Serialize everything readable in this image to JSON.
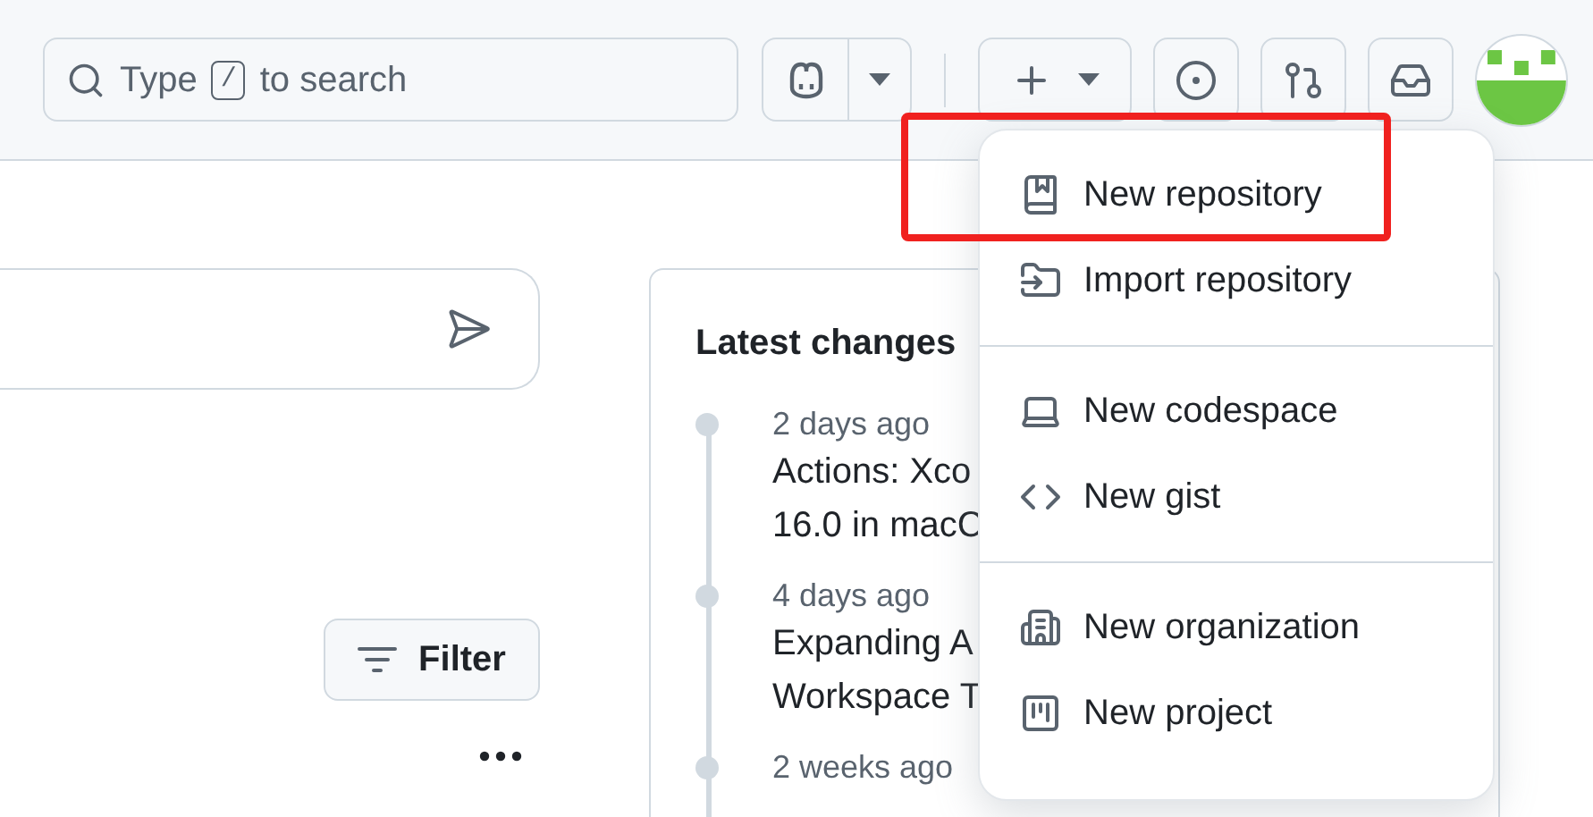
{
  "header": {
    "search": {
      "label_start": "Type",
      "key": "/",
      "label_end": "to search"
    }
  },
  "filter_button": {
    "label": "Filter"
  },
  "latest_changes": {
    "title": "Latest changes",
    "items": [
      {
        "time": "2 days ago",
        "lines": [
          "Actions: Xco",
          "16.0 in macC"
        ]
      },
      {
        "time": "4 days ago",
        "lines": [
          "Expanding A",
          "Workspace T"
        ]
      },
      {
        "time": "2 weeks ago"
      }
    ]
  },
  "create_menu": {
    "groups": [
      [
        {
          "label": "New repository",
          "kind": "repo"
        },
        {
          "label": "Import repository",
          "kind": "import"
        }
      ],
      [
        {
          "label": "New codespace",
          "kind": "codespace"
        },
        {
          "label": "New gist",
          "kind": "code"
        }
      ],
      [
        {
          "label": "New organization",
          "kind": "organization"
        },
        {
          "label": "New project",
          "kind": "project"
        }
      ]
    ]
  }
}
